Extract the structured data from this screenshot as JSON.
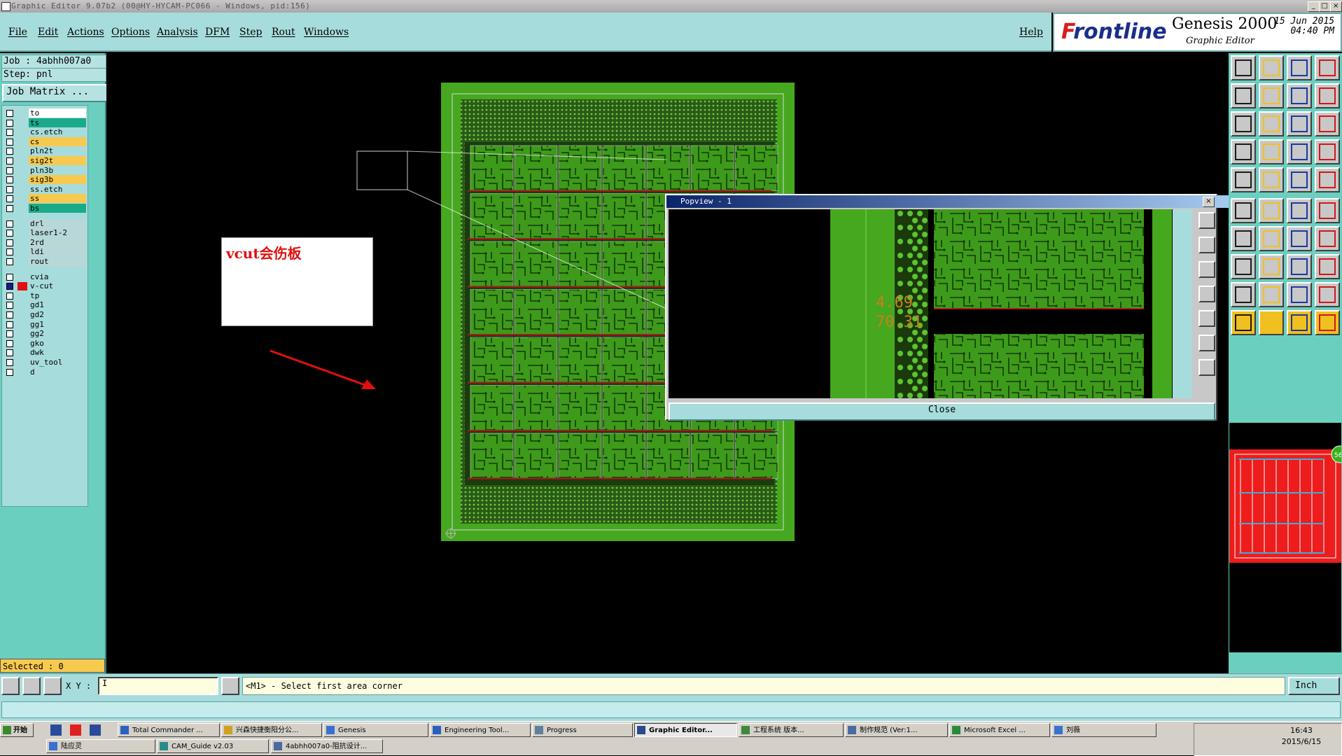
{
  "window": {
    "title": "Graphic Editor 9.07b2 (00@HY-HYCAM-PC066 - Windows, pid:156)",
    "controls": [
      "_",
      "□",
      "×"
    ]
  },
  "menu": {
    "items": [
      {
        "label": "File"
      },
      {
        "label": "Edit"
      },
      {
        "label": "Actions"
      },
      {
        "label": "Options"
      },
      {
        "label": "Analysis"
      },
      {
        "label": "DFM"
      },
      {
        "label": "Step"
      },
      {
        "label": "Rout"
      },
      {
        "label": "Windows"
      }
    ],
    "help": "Help"
  },
  "logo": {
    "brand": "Frontline",
    "product": "Genesis 2000",
    "subtitle": "Graphic Editor",
    "date": "15 Jun 2015",
    "time": "04:40 PM"
  },
  "job": {
    "job_line": "Job : 4abhh007a0",
    "step_line": "Step: pnl",
    "matrix_button": "Job Matrix ..."
  },
  "layers": [
    {
      "name": "to",
      "color": "#ffffff"
    },
    {
      "name": "ts",
      "color": "#1aaa8a"
    },
    {
      "name": "cs.etch",
      "color": "#a7dcdc"
    },
    {
      "name": "cs",
      "color": "#f7c94e"
    },
    {
      "name": "pln2t",
      "color": "#a7dcdc"
    },
    {
      "name": "sig2t",
      "color": "#f7c94e"
    },
    {
      "name": "pln3b",
      "color": "#a7dcdc"
    },
    {
      "name": "sig3b",
      "color": "#f7c94e"
    },
    {
      "name": "ss.etch",
      "color": "#a7dcdc"
    },
    {
      "name": "ss",
      "color": "#f7c94e"
    },
    {
      "name": "bs",
      "color": "#1aaa8a"
    },
    {
      "name": "drl",
      "color": "#b8d8d8"
    },
    {
      "name": "laser1-2",
      "color": "#b8d8d8"
    },
    {
      "name": "2rd",
      "color": "#b8d8d8"
    },
    {
      "name": "ldi",
      "color": "#b8d8d8"
    },
    {
      "name": "rout",
      "color": "#b8d8d8"
    },
    {
      "name": "cvia",
      "color": "#a7dcdc"
    },
    {
      "name": "v-cut",
      "color": "#a7dcdc"
    },
    {
      "name": "tp",
      "color": "#a7dcdc"
    },
    {
      "name": "gd1",
      "color": "#a7dcdc"
    },
    {
      "name": "gd2",
      "color": "#a7dcdc"
    },
    {
      "name": "gg1",
      "color": "#a7dcdc"
    },
    {
      "name": "gg2",
      "color": "#a7dcdc"
    },
    {
      "name": "gko",
      "color": "#a7dcdc"
    },
    {
      "name": "dwk",
      "color": "#a7dcdc"
    },
    {
      "name": "uv_tool",
      "color": "#a7dcdc"
    },
    {
      "name": "d",
      "color": "#a7dcdc"
    }
  ],
  "selected": "Selected : 0",
  "annotation": {
    "text": "vcut会伤板"
  },
  "popview": {
    "title": "Popview - 1",
    "close_label": "Close",
    "dims": [
      "4.69",
      "70.31"
    ]
  },
  "command": {
    "xy_label": "X Y :",
    "xy_value": "I",
    "message": "<M1> - Select first area corner",
    "units": "Inch"
  },
  "mini_badge": "56",
  "colors": {
    "board_green": "#45a81e",
    "board_dark": "#2e7a12",
    "accent_red": "#e01010",
    "panel_cyan": "#a7dcdc",
    "panel_teal": "#6bcfbf"
  },
  "taskbar": {
    "start": "开始",
    "row1": [
      {
        "label": "Total Commander ..."
      },
      {
        "label": "兴森快捷衡阳分公..."
      },
      {
        "label": "Genesis"
      },
      {
        "label": "Engineering Tool..."
      },
      {
        "label": "Progress"
      },
      {
        "label": "Graphic Editor..."
      },
      {
        "label": "工程系统  版本..."
      },
      {
        "label": "制作规范 (Ver:1..."
      },
      {
        "label": "Microsoft Excel ..."
      },
      {
        "label": "刘薇"
      }
    ],
    "row2": [
      {
        "label": "陆应灵"
      },
      {
        "label": "CAM_Guide v2.03"
      },
      {
        "label": "4abhh007a0-阻抗设计..."
      }
    ],
    "clock_time": "16:43",
    "clock_date": "2015/6/15"
  }
}
